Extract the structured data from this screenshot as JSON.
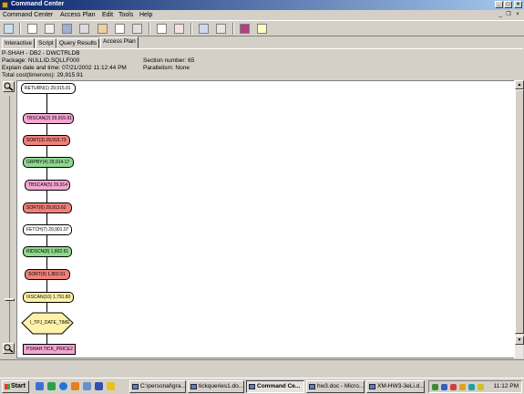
{
  "window": {
    "title": "Command Center",
    "minimize": "_",
    "maximize": "□",
    "close": "×",
    "mdi_minimize": "_",
    "mdi_restore": "❐",
    "mdi_close": "×"
  },
  "menu": [
    "Command Center",
    "Access Plan",
    "Edit",
    "Tools",
    "Help"
  ],
  "toolbar": {
    "icons": [
      "back-icon",
      "script-icon",
      "results-icon",
      "plan-icon",
      "chart-icon",
      "window-icon",
      "page-icon",
      "print-icon",
      "grid-icon",
      "tree-icon",
      "stop-icon",
      "help-icon"
    ]
  },
  "tabs": [
    "Interactive",
    "Script",
    "Query Results",
    "Access Plan"
  ],
  "active_tab": "Access Plan",
  "info": {
    "server": "P-SHAH - DB2 - DWCTRLDB",
    "package": "Package: NULLID.SQLLF000",
    "explain": "Explain date and time: 07/21/2002 11:12:44 PM",
    "total_cost": "Total cost(timerons): 29,915.91",
    "section": "Section number: 65",
    "parallelism": "Parallelism: None"
  },
  "plan_nodes": [
    {
      "label": "RETURN(1) 29,915.91",
      "color": "#ffffff"
    },
    {
      "label": "TBSCAN(2) 29,915.91",
      "color": "#f4a6d2"
    },
    {
      "label": "SORT(3) 29,915.73",
      "color": "#f0807a"
    },
    {
      "label": "GRPBY(4) 29,914.17",
      "color": "#8ed88e"
    },
    {
      "label": "TBSCAN(5) 29,914",
      "color": "#f4a6d2"
    },
    {
      "label": "SORT(6) 29,913.62",
      "color": "#f0807a"
    },
    {
      "label": "FETCH(7) 29,901.07",
      "color": "#ffffff"
    },
    {
      "label": "RIDSCN(8) 1,802.61",
      "color": "#8ed88e"
    },
    {
      "label": "SORT(9) 1,802.61",
      "color": "#f0807a"
    },
    {
      "label": "IXSCAN(10) 1,791.80",
      "color": "#fff2a8"
    },
    {
      "label": "I_TPJ_DATE_TIME",
      "color": "#fff2a8"
    },
    {
      "label": "PSHAH.TICK_PRICE2",
      "color": "#f4a6d2"
    }
  ],
  "taskbar": {
    "start": "Start",
    "buttons": [
      {
        "label": "C:\\personal\\gra...",
        "active": false
      },
      {
        "label": "tickqueries1.do...",
        "active": false
      },
      {
        "label": "Command Ce...",
        "active": true
      },
      {
        "label": "hw3.doc - Micro...",
        "active": false
      },
      {
        "label": "XM-HW3-3eLi.d...",
        "active": false
      }
    ],
    "clock": "11:12 PM"
  }
}
